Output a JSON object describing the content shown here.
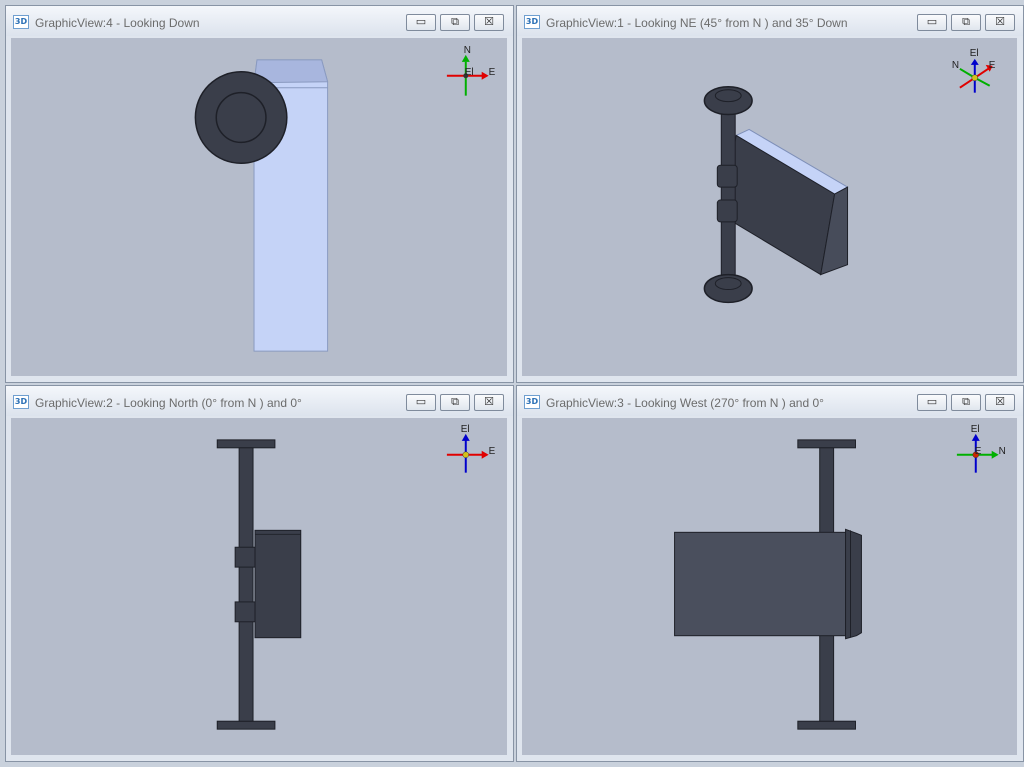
{
  "window_controls": {
    "minimize": "▭",
    "restore": "⧉",
    "close": "☒"
  },
  "views": [
    {
      "id": "view4",
      "icon": "3D",
      "title": "GraphicView:4 - Looking Down",
      "axes": {
        "up": "N",
        "right": "E",
        "center": "El"
      }
    },
    {
      "id": "view1",
      "icon": "3D",
      "title": "GraphicView:1 - Looking NE (45° from N ) and 35° Down",
      "axes": {
        "up": "El",
        "left": "N",
        "right": "E"
      }
    },
    {
      "id": "view2",
      "icon": "3D",
      "title": "GraphicView:2 - Looking North (0° from N ) and 0°",
      "axes": {
        "up": "El",
        "right": "E"
      }
    },
    {
      "id": "view3",
      "icon": "3D",
      "title": "GraphicView:3 - Looking West (270° from N ) and 0°",
      "axes": {
        "up": "El",
        "right": "N",
        "center": "E"
      }
    }
  ],
  "colors": {
    "viewport_bg": "#b5bccb",
    "model_dark": "#3a3e4a",
    "model_light": "#c5d3f7",
    "axis_x": "#e00000",
    "axis_y": "#00b000",
    "axis_z": "#0000cc"
  }
}
